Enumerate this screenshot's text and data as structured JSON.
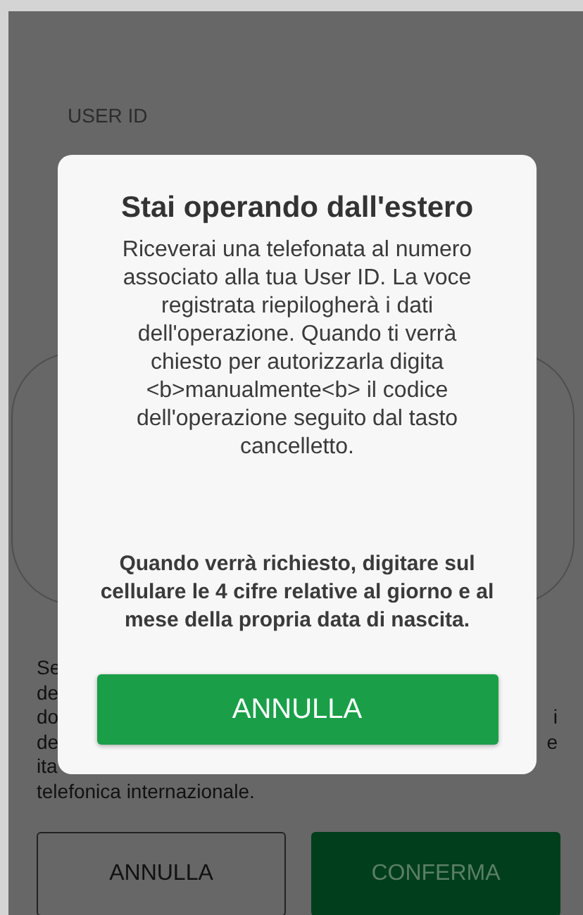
{
  "background": {
    "field_label": "USER ID",
    "paragraph_lines": [
      {
        "left": "Se"
      },
      {
        "left": "de"
      },
      {
        "left": "do",
        "right": "i"
      },
      {
        "left": "de",
        "right": "e"
      },
      {
        "left": "ita"
      },
      {
        "left": "telefonica internazionale."
      }
    ],
    "buttons": [
      {
        "label": "ANNULLA",
        "kind": "outline"
      },
      {
        "label": "CONFERMA",
        "kind": "primary"
      }
    ]
  },
  "dialog": {
    "title": "Stai operando dall'estero",
    "message": "Riceverai una telefonata al numero associato alla tua User ID. La voce registrata riepilogherà i dati dell'operazione. Quando ti verrà chiesto per autorizzarla digita <b>manualmente<b> il codice dell'operazione seguito dal tasto cancelletto.",
    "note": "Quando verrà richiesto, digitare sul cellulare le 4 cifre relative al giorno e al mese della propria data di nascita.",
    "button": "ANNULLA"
  }
}
